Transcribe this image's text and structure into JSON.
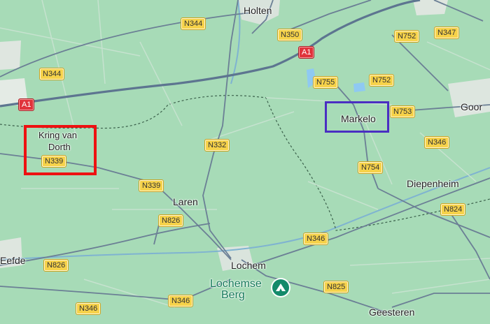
{
  "places": {
    "holten": "Holten",
    "goor": "Goor",
    "markelo": "Markelo",
    "kring_van_dorth_line1": "Kring van",
    "kring_van_dorth_line2": "Dorth",
    "diepenheim": "Diepenheim",
    "laren": "Laren",
    "eefde": "Eefde",
    "lochem": "Lochem",
    "geesteren": "Geesteren"
  },
  "poi": {
    "line1": "Lochemse",
    "line2": "Berg",
    "icon": "mountain-icon"
  },
  "roads": {
    "n344_top": "N344",
    "n344_left": "N344",
    "n350": "N350",
    "a1_top": "A1",
    "a1_left": "A1",
    "n752_top": "N752",
    "n347": "N347",
    "n755": "N755",
    "n752_mid": "N752",
    "n753": "N753",
    "n346_right": "N346",
    "n332": "N332",
    "n339_left": "N339",
    "n339_mid": "N339",
    "n754": "N754",
    "n824": "N824",
    "n826_mid": "N826",
    "n826_left": "N826",
    "n346_mid": "N346",
    "n825": "N825",
    "n346_bottom_left": "N346",
    "n346_bottom_mid": "N346"
  },
  "highlights": {
    "red": "#ee1111",
    "purple": "#4a2ec2"
  }
}
